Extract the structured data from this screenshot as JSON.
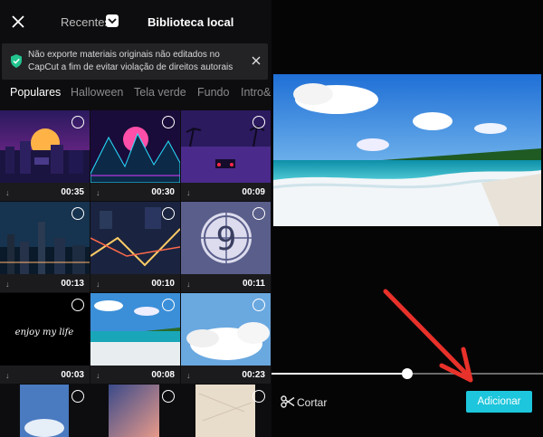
{
  "header": {
    "tab_recent": "Recentes",
    "tab_local": "Biblioteca local"
  },
  "notice": {
    "text": "Não exporte materiais originais não editados no CapCut a fim de evitar violação de direitos autorais"
  },
  "categories": [
    "Populares",
    "Halloween",
    "Tela verde",
    "Fundo",
    "Intro&"
  ],
  "grid": [
    {
      "duration": "00:35",
      "icon": "download-icon"
    },
    {
      "duration": "00:30",
      "icon": "download-icon"
    },
    {
      "duration": "00:09",
      "icon": "download-icon"
    },
    {
      "duration": "00:13",
      "icon": "download-icon"
    },
    {
      "duration": "00:10",
      "icon": "download-icon"
    },
    {
      "duration": "00:11",
      "icon": "download-icon"
    },
    {
      "duration": "00:03",
      "icon": "download-icon"
    },
    {
      "duration": "00:08",
      "icon": "download-icon"
    },
    {
      "duration": "00:23",
      "icon": "download-icon"
    },
    {
      "duration": "",
      "icon": ""
    },
    {
      "duration": "",
      "icon": ""
    },
    {
      "duration": "",
      "icon": ""
    }
  ],
  "thumb_texts": {
    "countdown": "9",
    "handwriting": "enjoy my life"
  },
  "preview": {
    "progress": 0.5
  },
  "actions": {
    "cut_label": "Cortar",
    "add_label": "Adicionar"
  },
  "colors": {
    "accent": "#1dc6dc",
    "arrow": "#e8312a"
  }
}
